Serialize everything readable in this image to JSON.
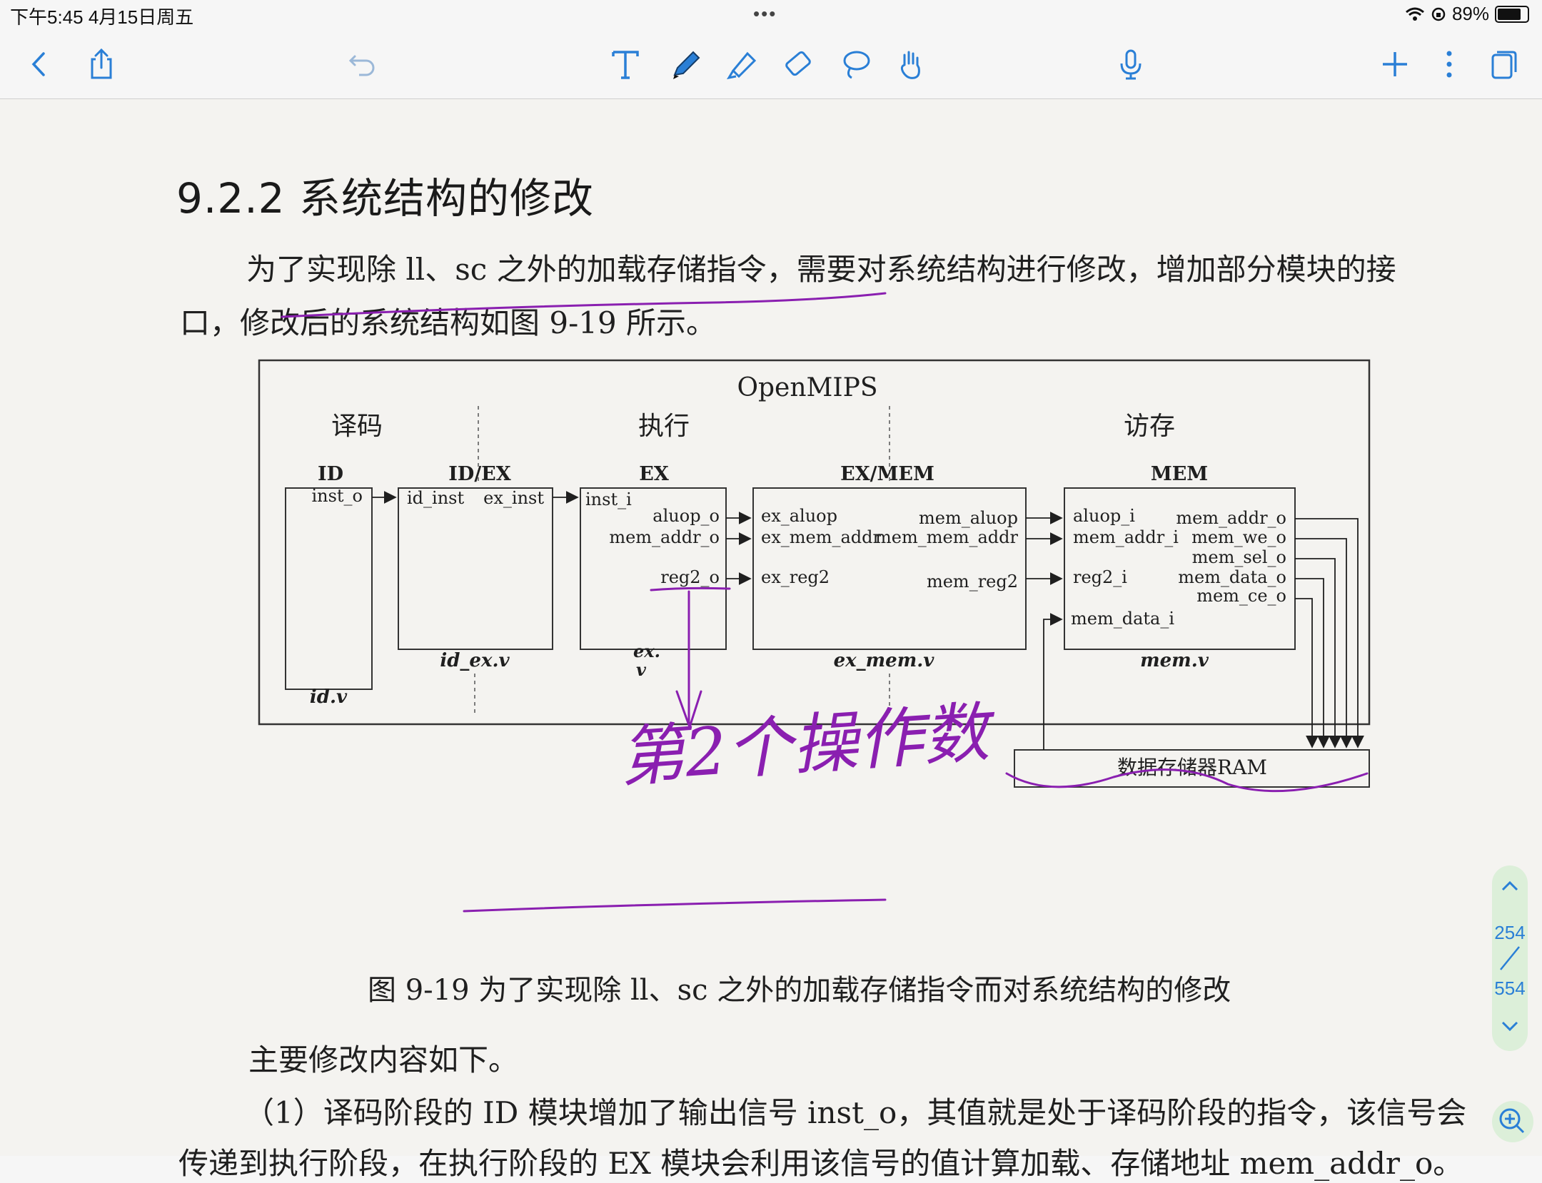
{
  "status": {
    "time": "下午5:45   4月15日周五",
    "dots": "•••",
    "battery": "89%",
    "battery_level": 0.89
  },
  "toolbar": {
    "left": [
      "back-icon",
      "share-icon",
      "undo-icon"
    ],
    "tools": [
      "text-tool-icon",
      "pen-icon",
      "highlighter-icon",
      "eraser-icon",
      "lasso-icon",
      "hand-icon"
    ],
    "right": [
      "microphone-icon",
      "add-icon",
      "more-icon",
      "pages-icon"
    ]
  },
  "doc": {
    "section_title": "9.2.2   系统结构的修改",
    "para1": "为了实现除 ll、sc 之外的加载存储指令，需要对系统结构进行修改，增加部分模块的接",
    "para2": "口，修改后的系统结构如图 9-19 所示。",
    "caption": "图 9-19    为了实现除 ll、sc 之外的加载存储指令而对系统结构的修改",
    "para3": "主要修改内容如下。",
    "para4": "（1）译码阶段的 ID 模块增加了输出信号 inst_o，其值就是处于译码阶段的指令，该信号会",
    "para5": "传递到执行阶段，在执行阶段的 EX 模块会利用该信号的值计算加载、存储地址 mem_addr_o。"
  },
  "diagram": {
    "title": "OpenMIPS",
    "stages": [
      "译码",
      "执行",
      "访存"
    ],
    "blocks": {
      "id": {
        "label": "ID",
        "file": "id.v",
        "ports": [
          "inst_o"
        ]
      },
      "id_ex": {
        "label": "ID/EX",
        "file": "id_ex.v",
        "ports": [
          "id_inst",
          "ex_inst"
        ]
      },
      "ex": {
        "label": "EX",
        "file_line1": "ex.",
        "file_line2": "v",
        "ports": [
          "inst_i",
          "aluop_o",
          "mem_addr_o",
          "reg2_o"
        ]
      },
      "ex_mem": {
        "label": "EX/MEM",
        "file": "ex_mem.v",
        "ports": [
          "ex_aluop",
          "ex_mem_addr",
          "ex_reg2",
          "mem_aluop",
          "mem_mem_addr",
          "mem_reg2"
        ]
      },
      "mem": {
        "label": "MEM",
        "file": "mem.v",
        "ports": [
          "aluop_i",
          "mem_addr_i",
          "reg2_i",
          "mem_data_i",
          "mem_addr_o",
          "mem_we_o",
          "mem_sel_o",
          "mem_data_o",
          "mem_ce_o"
        ]
      },
      "ram": {
        "label": "数据存储器RAM"
      }
    }
  },
  "annotation": {
    "handwriting": "第2个操作数",
    "ink_color": "#8a1fb0"
  },
  "pager": {
    "current": "254",
    "total": "554"
  }
}
